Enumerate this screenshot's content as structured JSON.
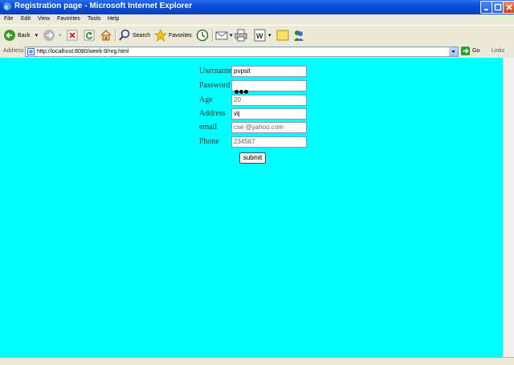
{
  "window": {
    "title": "Registration page - Microsoft Internet Explorer"
  },
  "menubar": {
    "items": [
      "File",
      "Edit",
      "View",
      "Favorites",
      "Tools",
      "Help"
    ]
  },
  "toolbar": {
    "back_label": "Back",
    "search_label": "Search",
    "favorites_label": "Favorites"
  },
  "addressbar": {
    "label": "Address",
    "url": "http://localhost:8080/week-9/reg.html",
    "go_label": "Go",
    "links_label": "Links"
  },
  "form": {
    "fields": [
      {
        "label": "Username",
        "value": "pvpsit"
      },
      {
        "label": "Password",
        "value": "",
        "masked_length": 3
      },
      {
        "label": "Age",
        "value": "20"
      },
      {
        "label": "Address",
        "value": "vij"
      },
      {
        "label": "email",
        "value": "cse @yahoo.com"
      },
      {
        "label": "Phone",
        "value": "234567"
      }
    ],
    "submit_label": "submit"
  },
  "colors": {
    "content_background": "#00ffff",
    "titlebar": "#0a4fd8"
  }
}
